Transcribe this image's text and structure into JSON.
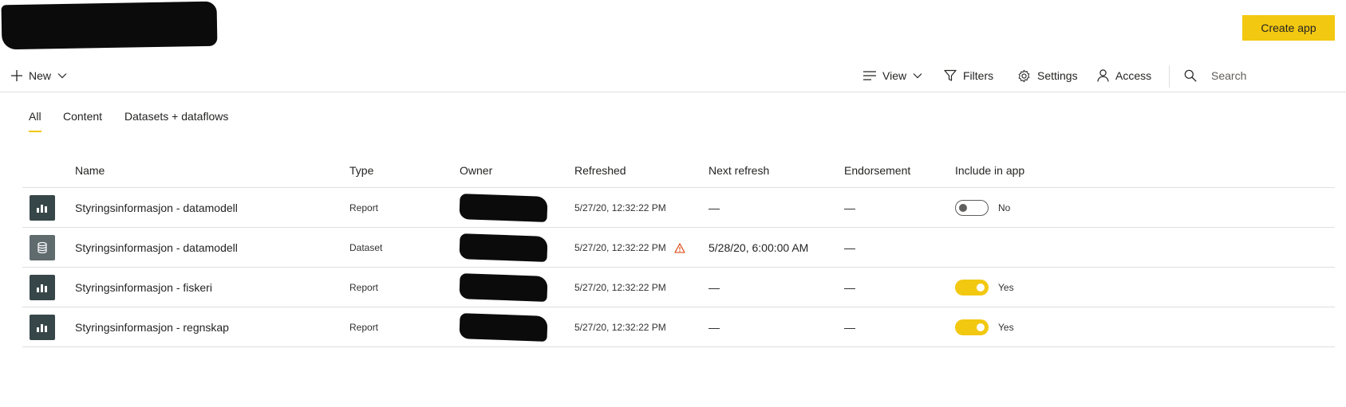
{
  "header": {
    "create_app_label": "Create app"
  },
  "toolbar": {
    "new_label": "New",
    "view_label": "View",
    "filters_label": "Filters",
    "settings_label": "Settings",
    "access_label": "Access",
    "search_placeholder": "Search"
  },
  "tabs": [
    {
      "label": "All",
      "active": true
    },
    {
      "label": "Content",
      "active": false
    },
    {
      "label": "Datasets + dataflows",
      "active": false
    }
  ],
  "table": {
    "columns": [
      "Name",
      "Type",
      "Owner",
      "Refreshed",
      "Next refresh",
      "Endorsement",
      "Include in app"
    ],
    "rows": [
      {
        "icon": "report-icon",
        "name": "Styringsinformasjon - datamodell",
        "type": "Report",
        "refreshed": "5/27/20, 12:32:22 PM",
        "warning": false,
        "next_refresh": "—",
        "endorsement": "—",
        "include_label": "No",
        "include_on": false
      },
      {
        "icon": "dataset-icon",
        "name": "Styringsinformasjon - datamodell",
        "type": "Dataset",
        "refreshed": "5/27/20, 12:32:22 PM",
        "warning": true,
        "next_refresh": "5/28/20, 6:00:00 AM",
        "endorsement": "—",
        "include_label": "",
        "include_on": null
      },
      {
        "icon": "report-icon",
        "name": "Styringsinformasjon - fiskeri",
        "type": "Report",
        "refreshed": "5/27/20, 12:32:22 PM",
        "warning": false,
        "next_refresh": "—",
        "endorsement": "—",
        "include_label": "Yes",
        "include_on": true
      },
      {
        "icon": "report-icon",
        "name": "Styringsinformasjon - regnskap",
        "type": "Report",
        "refreshed": "5/27/20, 12:32:22 PM",
        "warning": false,
        "next_refresh": "—",
        "endorsement": "—",
        "include_label": "Yes",
        "include_on": true
      }
    ]
  },
  "colors": {
    "accent": "#f2c811",
    "report_icon_bg": "#374649",
    "dataset_icon_bg": "#606b6e",
    "warning": "#d83b01"
  }
}
